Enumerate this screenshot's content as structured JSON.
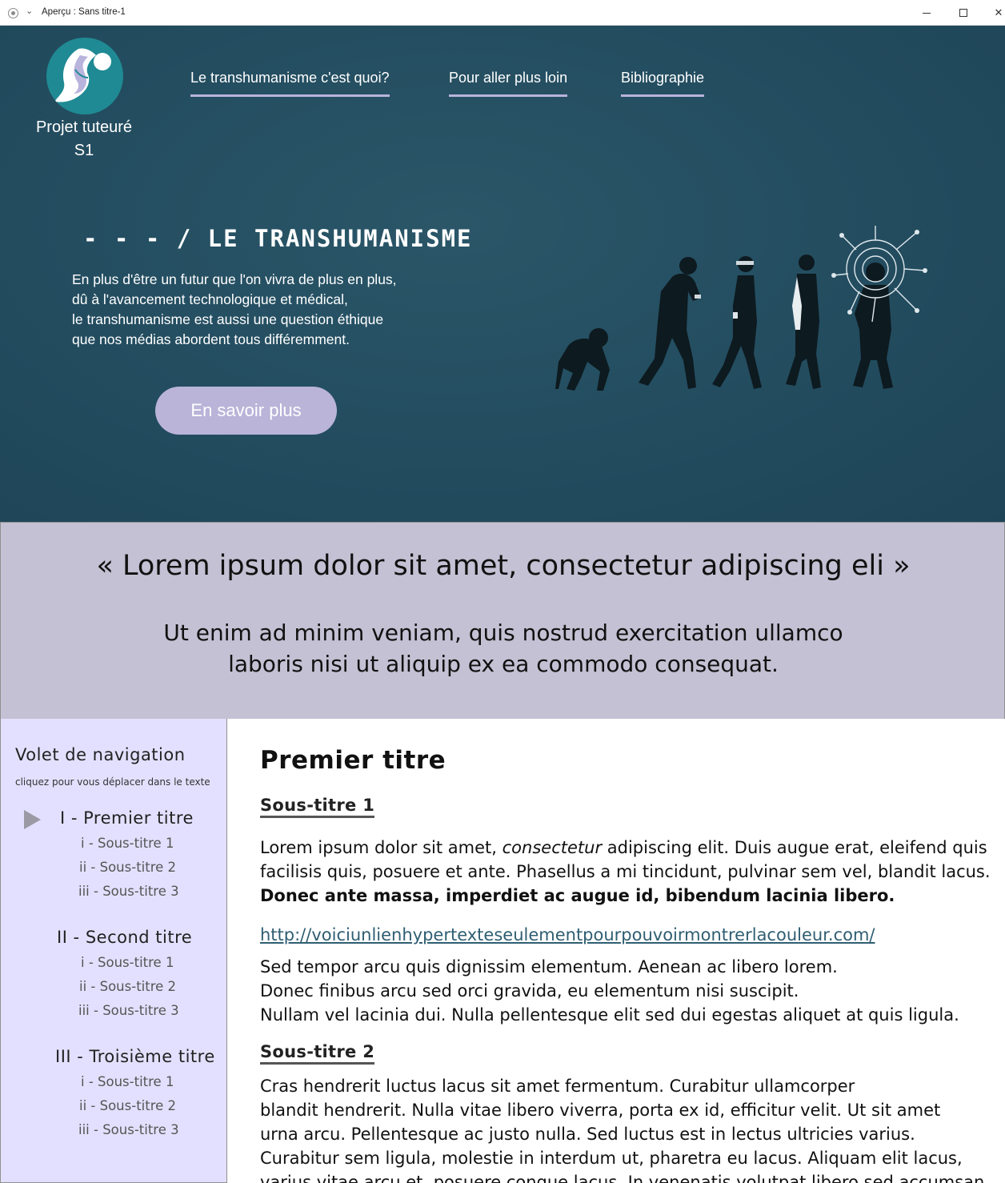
{
  "window": {
    "title": "Aperçu : Sans titre-1"
  },
  "header": {
    "logo_name_line1": "Projet tuteuré",
    "logo_name_line2": "S1",
    "nav": [
      {
        "label": "Le transhumanisme c'est quoi?"
      },
      {
        "label": "Pour aller plus loin"
      },
      {
        "label": "Bibliographie"
      }
    ]
  },
  "hero": {
    "title": "- - - / LE TRANSHUMANISME",
    "text_lines": [
      "En plus d'être un futur que l'on vivra de plus en plus,",
      "dû à l'avancement technologique et médical,",
      "le transhumanisme est aussi une question éthique",
      "que nos médias abordent tous différemment."
    ],
    "button_label": "En savoir plus"
  },
  "quote": {
    "main": "« Lorem ipsum dolor sit amet, consectetur adipiscing eli »",
    "sub_lines": [
      "Ut enim ad minim veniam, quis nostrud exercitation ullamco",
      "laboris nisi ut aliquip ex ea commodo consequat."
    ]
  },
  "sidebar": {
    "title": "Volet de navigation",
    "hint": "cliquez pour vous déplacer dans le texte",
    "sections": [
      {
        "label": "I  -  Premier titre",
        "subs": [
          "i  -  Sous-titre 1",
          "ii  -  Sous-titre 2",
          "iii -  Sous-titre 3"
        ]
      },
      {
        "label": "II  -  Second titre",
        "subs": [
          "i  -  Sous-titre 1",
          "ii  -  Sous-titre 2",
          "iii -  Sous-titre 3"
        ]
      },
      {
        "label": "III -  Troisième titre",
        "subs": [
          "i  -  Sous-titre 1",
          "ii  -  Sous-titre 2",
          "iii -  Sous-titre 3"
        ]
      }
    ]
  },
  "main": {
    "h1": "Premier titre",
    "sub1": "Sous-titre 1",
    "p1_a": "Lorem ipsum dolor sit amet, ",
    "p1_em": "consectetur",
    "p1_b": " adipiscing elit. Duis augue erat, eleifend quis",
    "p1_line2": "facilisis quis, posuere et ante. Phasellus a mi tincidunt, pulvinar sem vel, blandit lacus.",
    "p1_bold": "Donec ante massa, imperdiet ac augue id, bibendum lacinia libero.",
    "link": "http://voiciunlienhypertexteseulementpourpouvoirmontrerlacouleur.com/",
    "p2_lines": [
      "Sed tempor arcu quis dignissim elementum. Aenean ac libero lorem.",
      "Donec finibus arcu sed orci gravida, eu elementum nisi suscipit.",
      "Nullam vel lacinia dui. Nulla pellentesque elit sed dui egestas aliquet at quis ligula."
    ],
    "sub2": "Sous-titre 2",
    "p3_lines": [
      "Cras hendrerit luctus lacus sit amet fermentum. Curabitur ullamcorper",
      "blandit hendrerit. Nulla vitae libero viverra, porta ex id, efficitur velit. Ut sit amet",
      "urna arcu. Pellentesque ac justo nulla. Sed luctus est in lectus ultricies varius.",
      "Curabitur sem ligula, molestie in interdum ut, pharetra eu lacus. Aliquam elit lacus,",
      "varius vitae arcu et, posuere congue lacus. In venenatis volutpat libero sed accumsan."
    ]
  },
  "colors": {
    "hero_bg": "#234c5f",
    "nav_underline": "#b9b4dc",
    "button": "#b9b4d8",
    "quote_bg": "#c3c1d3",
    "sidebar_bg": "#e3e0ff",
    "link": "#2f5e72"
  }
}
